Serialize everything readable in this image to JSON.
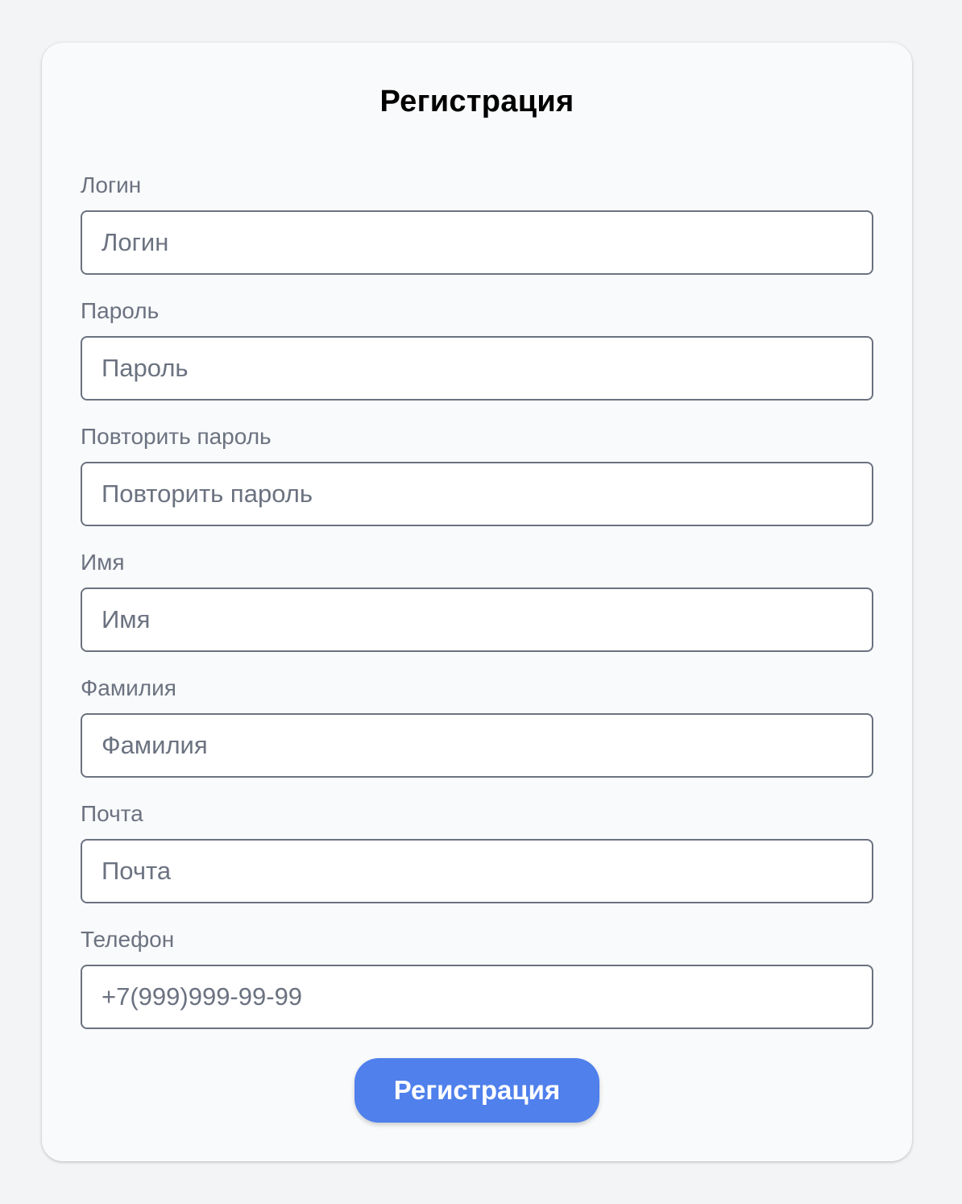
{
  "form": {
    "title": "Регистрация",
    "fields": [
      {
        "label": "Логин",
        "placeholder": "Логин",
        "value": ""
      },
      {
        "label": "Пароль",
        "placeholder": "Пароль",
        "value": ""
      },
      {
        "label": "Повторить пароль",
        "placeholder": "Повторить пароль",
        "value": ""
      },
      {
        "label": "Имя",
        "placeholder": "Имя",
        "value": ""
      },
      {
        "label": "Фамилия",
        "placeholder": "Фамилия",
        "value": ""
      },
      {
        "label": "Почта",
        "placeholder": "Почта",
        "value": ""
      },
      {
        "label": "Телефон",
        "placeholder": "+7(999)999-99-99",
        "value": ""
      }
    ],
    "submit_label": "Регистрация"
  },
  "colors": {
    "page_background": "#f3f4f6",
    "card_background": "#f9fafb",
    "label_text": "#6b7280",
    "input_border": "#6b7280",
    "button_background": "#4f80ec",
    "button_text": "#ffffff"
  }
}
